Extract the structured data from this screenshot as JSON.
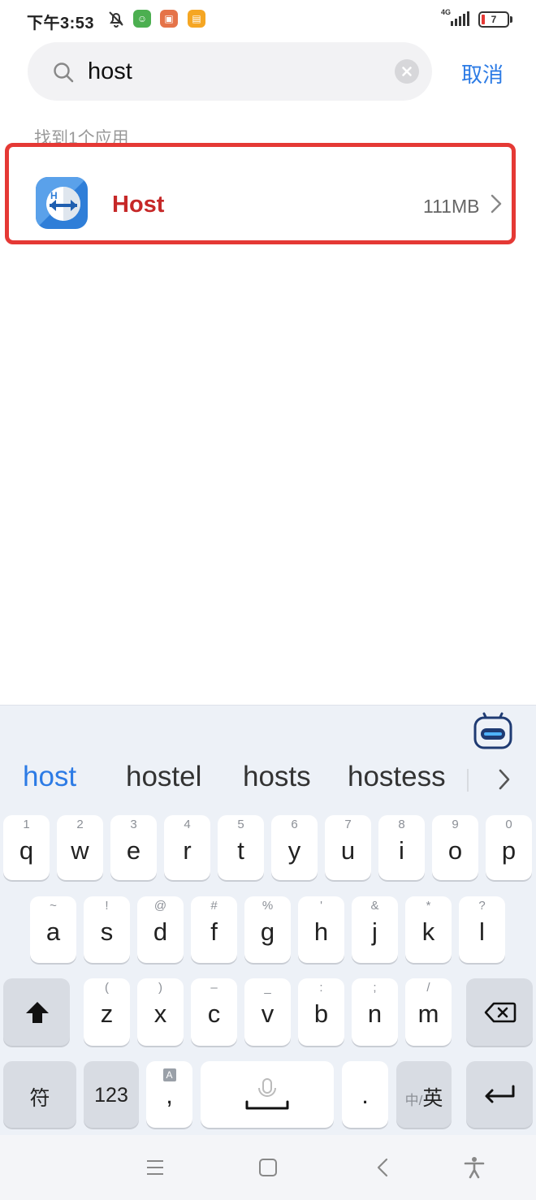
{
  "status_bar": {
    "time": "下午3:53",
    "network": "4G",
    "battery": "7"
  },
  "search": {
    "query": "host",
    "cancel_label": "取消"
  },
  "results": {
    "found_label": "找到1个应用",
    "items": [
      {
        "name": "Host",
        "size": "111MB"
      }
    ]
  },
  "keyboard": {
    "suggestions": [
      "host",
      "hostel",
      "hosts",
      "hostess"
    ],
    "row1": [
      {
        "k": "q",
        "h": "1"
      },
      {
        "k": "w",
        "h": "2"
      },
      {
        "k": "e",
        "h": "3"
      },
      {
        "k": "r",
        "h": "4"
      },
      {
        "k": "t",
        "h": "5"
      },
      {
        "k": "y",
        "h": "6"
      },
      {
        "k": "u",
        "h": "7"
      },
      {
        "k": "i",
        "h": "8"
      },
      {
        "k": "o",
        "h": "9"
      },
      {
        "k": "p",
        "h": "0"
      }
    ],
    "row2": [
      {
        "k": "a",
        "h": "~"
      },
      {
        "k": "s",
        "h": "!"
      },
      {
        "k": "d",
        "h": "@"
      },
      {
        "k": "f",
        "h": "#"
      },
      {
        "k": "g",
        "h": "%"
      },
      {
        "k": "h",
        "h": "'"
      },
      {
        "k": "j",
        "h": "&"
      },
      {
        "k": "k",
        "h": "*"
      },
      {
        "k": "l",
        "h": "?"
      }
    ],
    "row3": [
      {
        "k": "z",
        "h": "("
      },
      {
        "k": "x",
        "h": ")"
      },
      {
        "k": "c",
        "h": "–"
      },
      {
        "k": "v",
        "h": "_"
      },
      {
        "k": "b",
        "h": ":"
      },
      {
        "k": "n",
        "h": ";"
      },
      {
        "k": "m",
        "h": "/"
      }
    ],
    "symbols_label": "符",
    "numbers_label": "123",
    "comma_label": ",",
    "comma_hint": "A",
    "period_label": ".",
    "lang_secondary": "中/",
    "lang_primary": "英"
  }
}
